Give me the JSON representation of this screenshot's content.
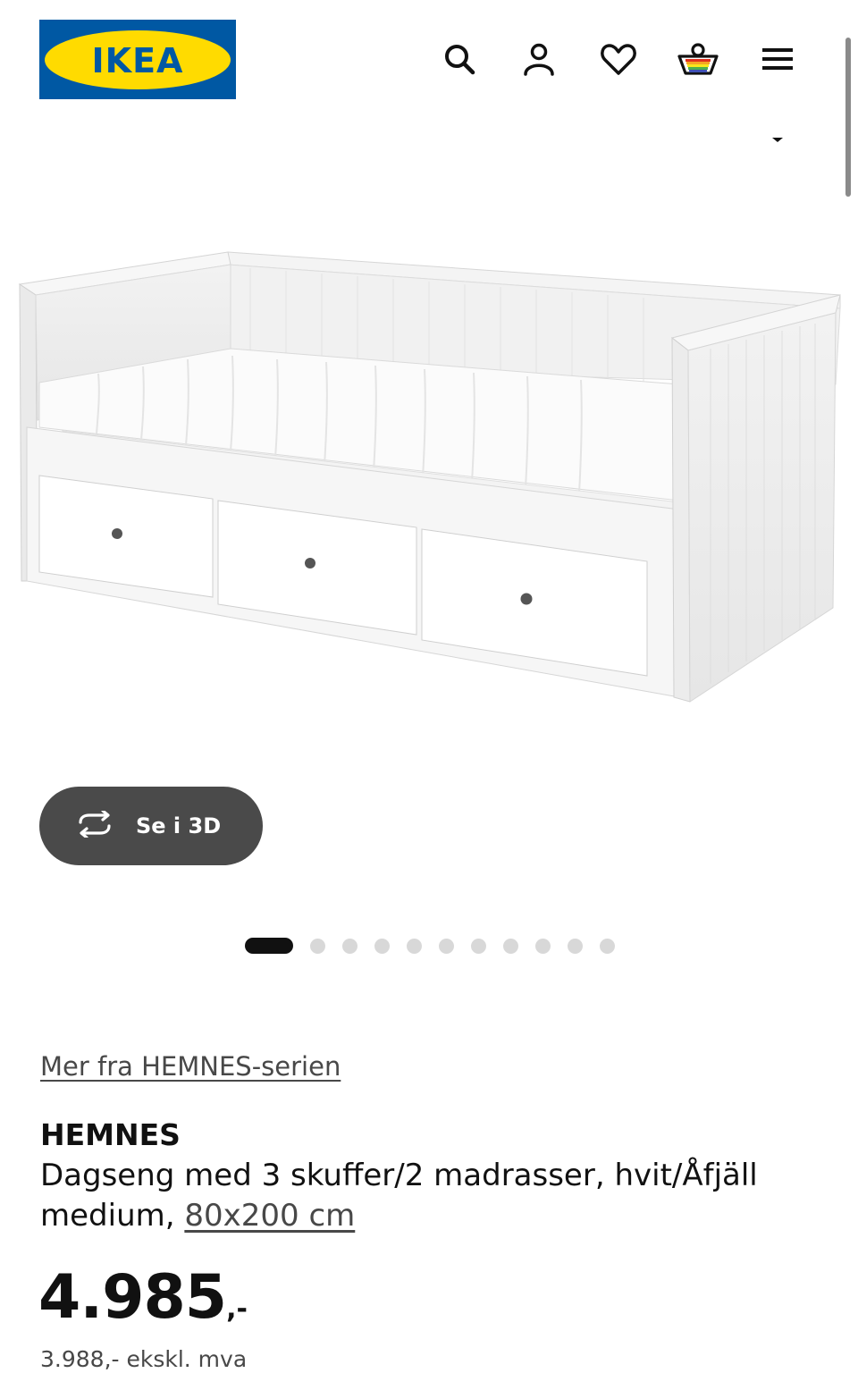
{
  "header": {
    "logo_text": "IKEA",
    "logo_registered": "®",
    "icons": [
      "search-icon",
      "user-icon",
      "heart-icon",
      "shopping-basket-icon",
      "hamburger-menu-icon"
    ]
  },
  "media": {
    "view_3d_label": "Se i 3D",
    "carousel_total": 11,
    "carousel_active_index": 0
  },
  "product": {
    "series_link": "Mer fra HEMNES-serien",
    "name": "HEMNES",
    "description": "Dagseng med 3 skuffer/2 madrasser, hvit/Åfjäll medium, ",
    "size": "80x200 cm",
    "price_main": "4.985",
    "price_suffix": ",-",
    "price_ex_vat": "3.988,- ekskl. mva"
  },
  "colors": {
    "brand_blue": "#0058a3",
    "brand_yellow": "#ffdb00",
    "button_dark": "#4a4a4a"
  }
}
